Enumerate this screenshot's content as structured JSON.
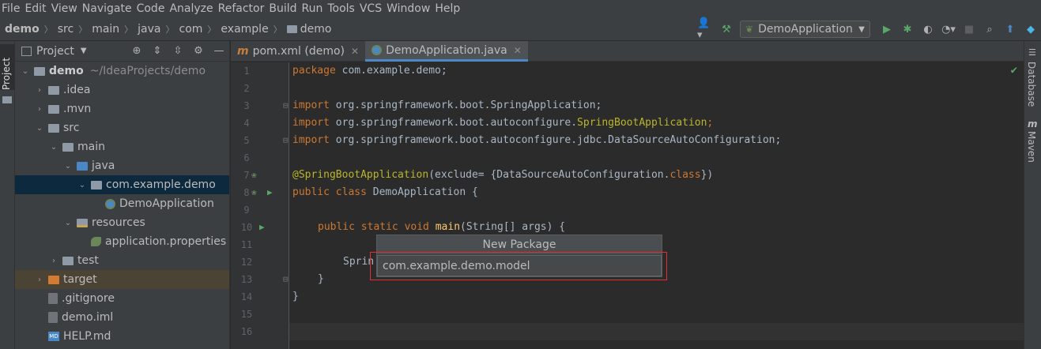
{
  "menu": [
    "File",
    "Edit",
    "View",
    "Navigate",
    "Code",
    "Analyze",
    "Refactor",
    "Build",
    "Run",
    "Tools",
    "VCS",
    "Window",
    "Help"
  ],
  "breadcrumbs": [
    "demo",
    "src",
    "main",
    "java",
    "com",
    "example",
    "demo"
  ],
  "run_config": "DemoApplication",
  "left_stripe": {
    "project_tab": "Project"
  },
  "right_stripe": {
    "database_tab": "Database",
    "maven_tab": "Maven"
  },
  "project_panel": {
    "title": "Project",
    "tree": [
      {
        "label": "demo",
        "hint": "~/IdeaProjects/demo",
        "depth": 0,
        "expanded": true,
        "icon": "module-folder-icon"
      },
      {
        "label": ".idea",
        "depth": 1,
        "expanded": false,
        "icon": "folder-icon"
      },
      {
        "label": ".mvn",
        "depth": 1,
        "expanded": false,
        "icon": "folder-icon"
      },
      {
        "label": "src",
        "depth": 1,
        "expanded": true,
        "icon": "folder-icon"
      },
      {
        "label": "main",
        "depth": 2,
        "expanded": true,
        "icon": "folder-icon"
      },
      {
        "label": "java",
        "depth": 3,
        "expanded": true,
        "icon": "source-folder-icon"
      },
      {
        "label": "com.example.demo",
        "depth": 4,
        "expanded": true,
        "icon": "package-icon",
        "selected": true
      },
      {
        "label": "DemoApplication",
        "depth": 5,
        "icon": "spring-class-icon"
      },
      {
        "label": "resources",
        "depth": 3,
        "expanded": true,
        "icon": "resources-folder-icon"
      },
      {
        "label": "application.properties",
        "depth": 4,
        "icon": "properties-file-icon"
      },
      {
        "label": "test",
        "depth": 2,
        "expanded": false,
        "icon": "folder-icon"
      },
      {
        "label": "target",
        "depth": 1,
        "expanded": false,
        "icon": "excluded-folder-icon"
      },
      {
        "label": ".gitignore",
        "depth": 1,
        "icon": "file-icon"
      },
      {
        "label": "demo.iml",
        "depth": 1,
        "icon": "file-icon"
      },
      {
        "label": "HELP.md",
        "depth": 1,
        "icon": "markdown-file-icon"
      }
    ]
  },
  "editor_tabs": [
    {
      "label": "pom.xml (demo)",
      "active": false
    },
    {
      "label": "DemoApplication.java",
      "active": true
    }
  ],
  "line_numbers": [
    "1",
    "2",
    "3",
    "4",
    "5",
    "6",
    "7",
    "8",
    "9",
    "10",
    "11",
    "12",
    "13",
    "14",
    "15",
    "16"
  ],
  "code_lines": {
    "l1_kw": "package",
    "l1_rest": " com.example.demo;",
    "l3_kw": "import",
    "l3_rest": " org.springframework.boot.SpringApplication;",
    "l4_kw": "import",
    "l4_rest": " org.springframework.boot.autoconfigure.",
    "l4_hl": "SpringBootApplication",
    "l4_end": ";",
    "l5_kw": "import",
    "l5_rest": " org.springframework.boot.autoconfigure.jdbc.DataSourceAutoConfiguration;",
    "l7_ann": "@SpringBootApplication",
    "l7_rest": "(exclude= {DataSourceAutoConfiguration.",
    "l7_kw": "class",
    "l7_end": "})",
    "l8_kw": "public class",
    "l8_rest": " DemoApplication {",
    "l10_kw": "public static void",
    "l10_fn": " main",
    "l10_rest": "(String[] args) {",
    "l12_rest": "Sprin",
    "l13_rest": "}",
    "l14_rest": "}"
  },
  "new_package_dialog": {
    "title": "New Package",
    "value": "com.example.demo.model"
  },
  "colors": {
    "accent": "#4a88c7",
    "highlight_box": "#e0312c",
    "selection": "#0d293e"
  }
}
